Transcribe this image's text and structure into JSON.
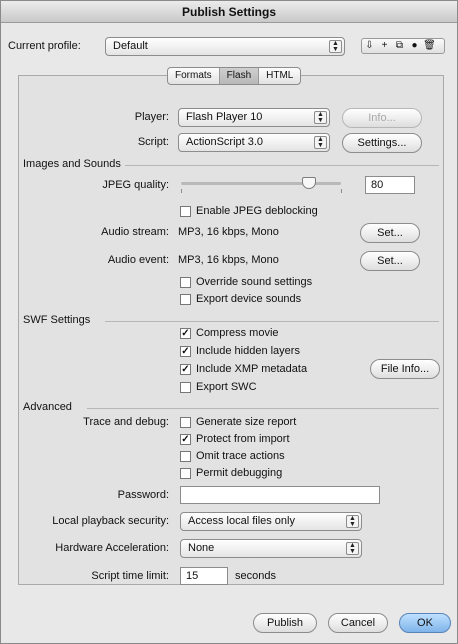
{
  "window": {
    "title": "Publish Settings"
  },
  "profile": {
    "label": "Current profile:",
    "value": "Default"
  },
  "toolbar_icons": {
    "import_export": "import-export-icon",
    "add": "plus-icon",
    "duplicate": "duplicate-icon",
    "info": "info-icon",
    "delete": "trash-icon"
  },
  "tabs": [
    {
      "label": "Formats"
    },
    {
      "label": "Flash"
    },
    {
      "label": "HTML"
    }
  ],
  "player": {
    "label": "Player:",
    "value": "Flash Player 10",
    "info_label": "Info..."
  },
  "script": {
    "label": "Script:",
    "value": "ActionScript 3.0",
    "settings_label": "Settings..."
  },
  "images_sounds": {
    "heading": "Images and Sounds",
    "jpeg_label": "JPEG quality:",
    "jpeg_value": "80",
    "jpeg_fraction": 0.8,
    "deblock_label": "Enable JPEG deblocking",
    "deblock_checked": false,
    "audio_stream_label": "Audio stream:",
    "audio_stream_value": "MP3, 16 kbps, Mono",
    "audio_event_label": "Audio event:",
    "audio_event_value": "MP3, 16 kbps, Mono",
    "set_label": "Set...",
    "override_label": "Override sound settings",
    "override_checked": false,
    "export_device_label": "Export device sounds",
    "export_device_checked": false
  },
  "swf": {
    "heading": "SWF Settings",
    "compress_label": "Compress movie",
    "compress_checked": true,
    "hidden_label": "Include hidden layers",
    "hidden_checked": true,
    "xmp_label": "Include XMP metadata",
    "xmp_checked": true,
    "swc_label": "Export SWC",
    "swc_checked": false,
    "file_info_label": "File Info..."
  },
  "advanced": {
    "heading": "Advanced",
    "trace_label": "Trace and debug:",
    "size_report_label": "Generate size report",
    "size_report_checked": false,
    "protect_label": "Protect from import",
    "protect_checked": true,
    "omit_label": "Omit trace actions",
    "omit_checked": false,
    "permit_label": "Permit debugging",
    "permit_checked": false,
    "password_label": "Password:",
    "password_value": "",
    "local_label": "Local playback security:",
    "local_value": "Access local files only",
    "hw_label": "Hardware Acceleration:",
    "hw_value": "None",
    "time_label": "Script time limit:",
    "time_value": "15",
    "time_unit": "seconds"
  },
  "footer": {
    "publish": "Publish",
    "cancel": "Cancel",
    "ok": "OK"
  },
  "check_glyph": "✓"
}
